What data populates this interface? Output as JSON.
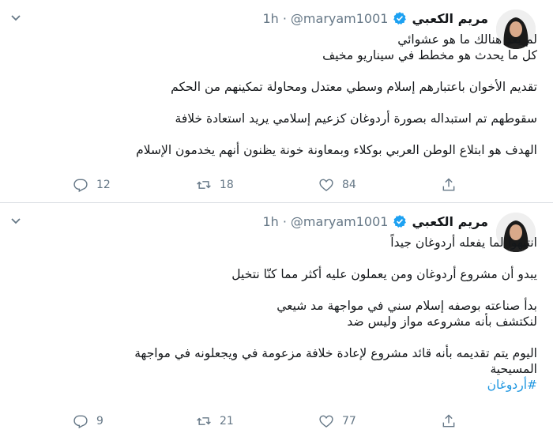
{
  "tweets": [
    {
      "name": "مريم الكعبي",
      "handle": "@maryam1001",
      "dot": "·",
      "time": "1h",
      "lines": [
        "لم يعد هنالك ما هو عشوائي",
        "كل ما يحدث هو مخطط في سيناريو مخيف",
        "تقديم الأخوان باعتبارهم إسلام وسطي معتدل ومحاولة تمكينهم من الحكم",
        "سقوطهم تم استبداله بصورة أردوغان كزعيم إسلامي يريد استعادة خلافة",
        "الهدف هو ابتلاع الوطن العربي بوكلاء وبمعاونة خونة يظنون أنهم يخدمون الإسلام"
      ],
      "replies": "12",
      "retweets": "18",
      "likes": "84"
    },
    {
      "name": "مريم الكعبي",
      "handle": "@maryam1001",
      "dot": "·",
      "time": "1h",
      "lines": [
        "انتبهوا لما يفعله أردوغان جيداً",
        "يبدو أن مشروع أردوغان ومن يعملون عليه  أكثر مما كنّا نتخيل",
        "بدأ صناعته بوصفه إسلام سني في مواجهة مد شيعي",
        "لنكتشف بأنه مشروعه مواز وليس ضد",
        "اليوم يتم تقديمه بأنه قائد مشروع لإعادة خلافة مزعومة في ويجعلونه في مواجهة",
        "المسيحية"
      ],
      "hashtag": "#أردوغان",
      "replies": "9",
      "retweets": "21",
      "likes": "77"
    }
  ],
  "icons": {
    "reply": "reply-icon",
    "retweet": "retweet-icon",
    "like": "like-icon",
    "share": "share-icon",
    "verified": "verified-icon",
    "caret": "chevron-down-icon"
  },
  "colors": {
    "text": "#14171a",
    "muted": "#657786",
    "link": "#1b95e0",
    "verified": "#1da1f2",
    "divider": "#d8dde2"
  }
}
